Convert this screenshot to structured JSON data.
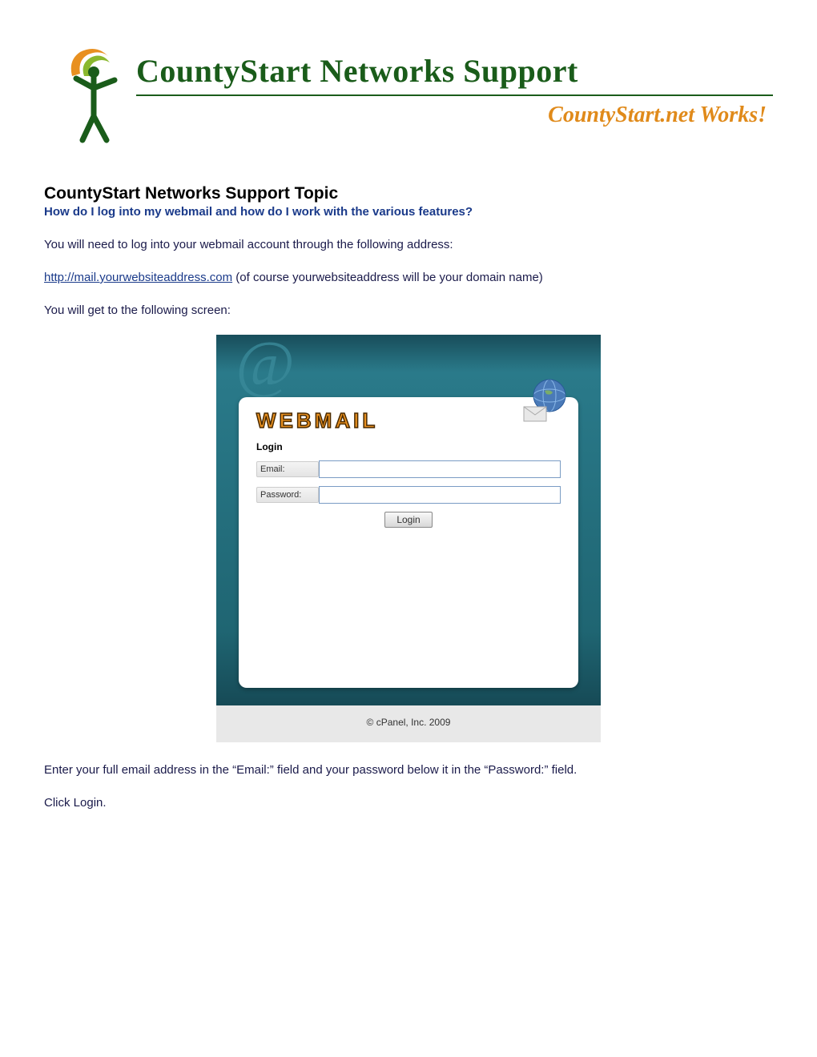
{
  "header": {
    "title": "CountyStart Networks Support",
    "tagline": "CountyStart.net Works!"
  },
  "topic": {
    "heading": "CountyStart Networks Support Topic",
    "question": "How do I log into my webmail and how do I work with the various features?"
  },
  "body": {
    "intro": "You will need to log into your webmail account through the following address:",
    "link_text": "http://mail.yourwebsiteaddress.com",
    "link_after": " (of course yourwebsiteaddress will be your domain name)",
    "screen_intro": "You will get to the following screen:",
    "instructions": "Enter your full email address in the “Email:” field and your password below it in the “Password:” field.",
    "click_login": "Click Login."
  },
  "login_form": {
    "brand": "WEBMAIL",
    "heading": "Login",
    "email_label": "Email:",
    "password_label": "Password:",
    "button": "Login",
    "copyright": "© cPanel, Inc. 2009"
  }
}
